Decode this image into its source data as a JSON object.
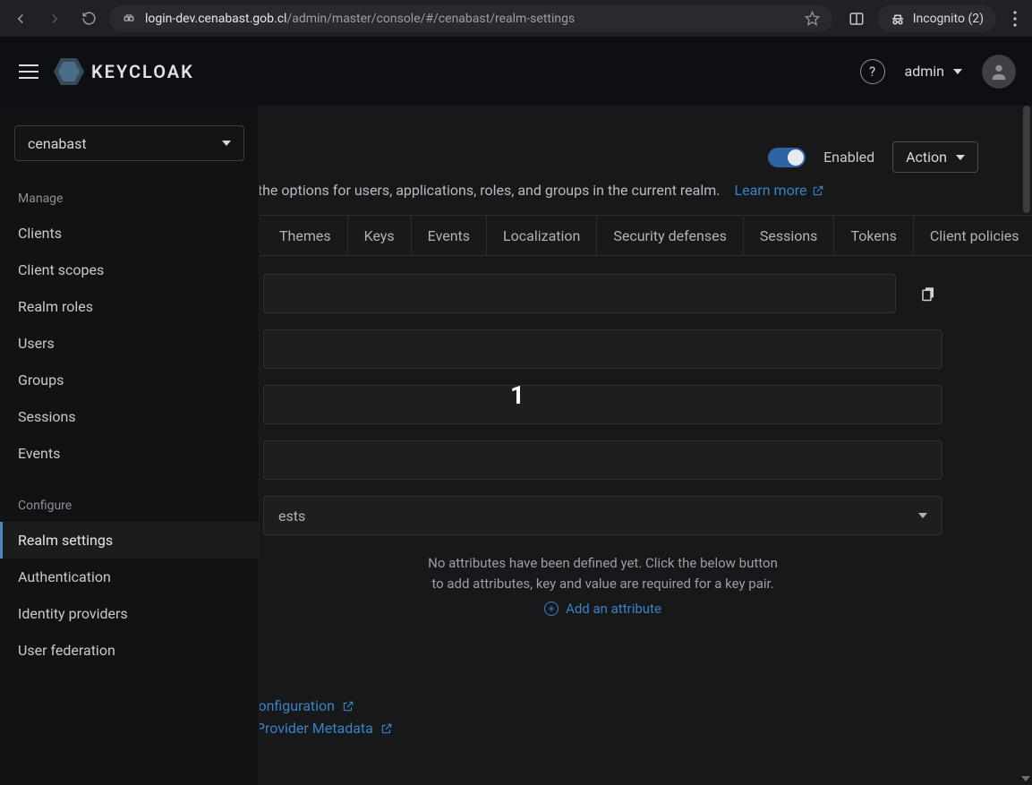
{
  "browser": {
    "url_host": "login-dev.cenabast.gob.cl",
    "url_path": "/admin/master/console/#/cenabast/realm-settings",
    "incognito_label": "Incognito (2)"
  },
  "header": {
    "logo_text": "KEYCLOAK",
    "username": "admin"
  },
  "sidebar": {
    "realm_selected": "cenabast",
    "section_manage": "Manage",
    "section_configure": "Configure",
    "items_manage": [
      {
        "label": "Clients"
      },
      {
        "label": "Client scopes"
      },
      {
        "label": "Realm roles"
      },
      {
        "label": "Users"
      },
      {
        "label": "Groups"
      },
      {
        "label": "Sessions"
      },
      {
        "label": "Events"
      }
    ],
    "items_configure": [
      {
        "label": "Realm settings",
        "active": true
      },
      {
        "label": "Authentication"
      },
      {
        "label": "Identity providers"
      },
      {
        "label": "User federation"
      }
    ]
  },
  "realm_top": {
    "enabled_label": "Enabled",
    "action_label": "Action",
    "description": "l the options for users, applications, roles, and groups in the current realm.",
    "learn_more": "Learn more"
  },
  "tabs": [
    "Themes",
    "Keys",
    "Events",
    "Localization",
    "Security defenses",
    "Sessions",
    "Tokens",
    "Client policies"
  ],
  "form": {
    "select_value_partial": "ests",
    "empty_msg": "No attributes have been defined yet. Click the below button to add attributes, key and value are required for a key pair.",
    "add_attribute": "Add an attribute"
  },
  "endpoints": {
    "oidc_partial": "nt Configuration",
    "saml_partial": "tity Provider Metadata"
  },
  "overlay": {
    "number": "1"
  }
}
